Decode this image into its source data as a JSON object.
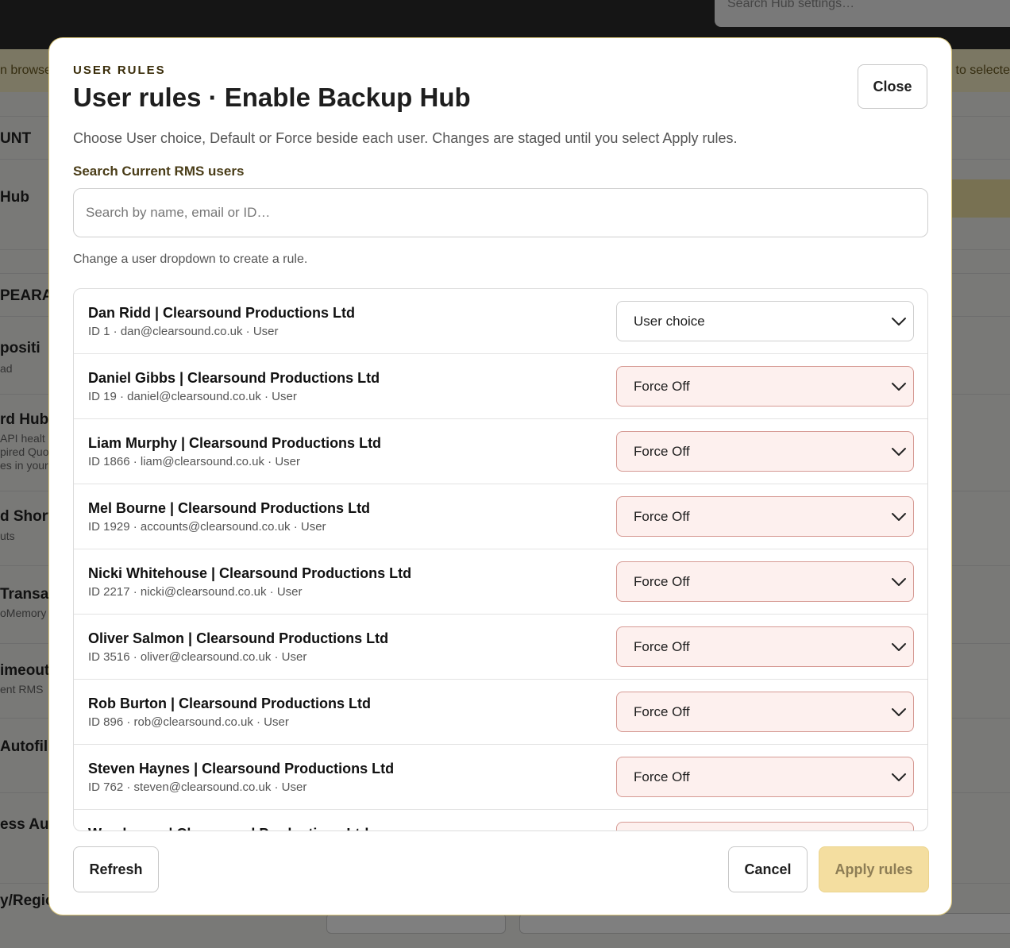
{
  "background": {
    "search_placeholder": "Search Hub settings…",
    "banner_left": "n browse",
    "banner_right": "s to selecte",
    "side_items": [
      {
        "label": "UNT",
        "sub": ""
      },
      {
        "label": "Hub",
        "sub": ""
      },
      {
        "label": "PEARA",
        "sub": ""
      },
      {
        "label": "positi",
        "sub": "ad"
      },
      {
        "label": "rd Hub",
        "sub": "API healt"
      },
      {
        "label": "",
        "sub": "pired Quo"
      },
      {
        "label": "",
        "sub": "es in your"
      },
      {
        "label": "d Short",
        "sub": "uts"
      },
      {
        "label": "Transac",
        "sub": "oMemory"
      },
      {
        "label": "imeout",
        "sub": "ent RMS"
      },
      {
        "label": "Autofil",
        "sub": ""
      },
      {
        "label": "ess Au",
        "sub": ""
      },
      {
        "label": "y/Regio",
        "sub": ""
      }
    ]
  },
  "modal": {
    "eyebrow": "USER RULES",
    "title": "User rules · Enable Backup Hub",
    "close_label": "Close",
    "description": "Choose User choice, Default or Force beside each user. Changes are staged until you select Apply rules.",
    "search_label": "Search Current RMS users",
    "search_placeholder": "Search by name, email or ID…",
    "search_value": "",
    "hint": "Change a user dropdown to create a rule.",
    "users": [
      {
        "name": "Dan Ridd | Clearsound Productions Ltd",
        "meta": "ID 1 · dan@clearsound.co.uk · User",
        "rule": "User choice"
      },
      {
        "name": "Daniel Gibbs | Clearsound Productions Ltd",
        "meta": "ID 19 · daniel@clearsound.co.uk · User",
        "rule": "Force Off"
      },
      {
        "name": "Liam Murphy | Clearsound Productions Ltd",
        "meta": "ID 1866 · liam@clearsound.co.uk · User",
        "rule": "Force Off"
      },
      {
        "name": "Mel Bourne | Clearsound Productions Ltd",
        "meta": "ID 1929 · accounts@clearsound.co.uk · User",
        "rule": "Force Off"
      },
      {
        "name": "Nicki Whitehouse | Clearsound Productions Ltd",
        "meta": "ID 2217 · nicki@clearsound.co.uk · User",
        "rule": "Force Off"
      },
      {
        "name": "Oliver Salmon | Clearsound Productions Ltd",
        "meta": "ID 3516 · oliver@clearsound.co.uk · User",
        "rule": "Force Off"
      },
      {
        "name": "Rob Burton | Clearsound Productions Ltd",
        "meta": "ID 896 · rob@clearsound.co.uk · User",
        "rule": "Force Off"
      },
      {
        "name": "Steven Haynes | Clearsound Productions Ltd",
        "meta": "ID 762 · steven@clearsound.co.uk · User",
        "rule": "Force Off"
      },
      {
        "name": "Warehouse | Clearsound Productions Ltd",
        "meta": "",
        "rule": ""
      }
    ],
    "refresh_label": "Refresh",
    "cancel_label": "Cancel",
    "apply_label": "Apply rules"
  },
  "colors": {
    "accent": "#f4dea0",
    "force_bg": "#fdf0ee",
    "force_border": "#d69a94"
  }
}
